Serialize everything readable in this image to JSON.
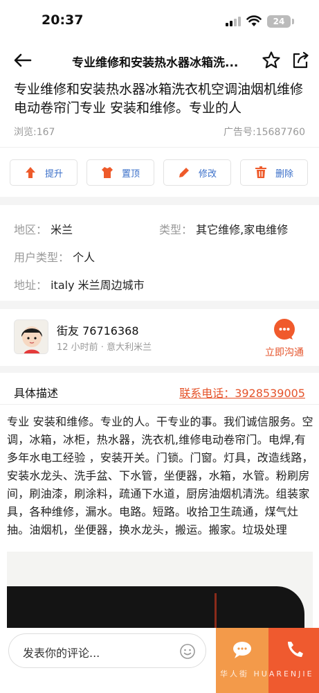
{
  "status_bar": {
    "time": "20:37",
    "battery": "24"
  },
  "nav": {
    "title": "专业维修和安装热水器冰箱洗..."
  },
  "post": {
    "headline": "专业维修和安装热水器冰箱洗衣机空调油烟机维修电动卷帘门专业 安装和维修。专业的人",
    "views": "浏览:167",
    "ad_number": "广告号:15687760"
  },
  "actions": [
    {
      "label": "提升",
      "icon": "arrow-up-icon"
    },
    {
      "label": "置顶",
      "icon": "shirt-icon"
    },
    {
      "label": "修改",
      "icon": "pencil-icon"
    },
    {
      "label": "删除",
      "icon": "trash-icon"
    }
  ],
  "info": {
    "region_label": "地区：",
    "region_value": "米兰",
    "type_label": "类型：",
    "type_value": "其它维修,家电维修",
    "user_type_label": "用户类型：",
    "user_type_value": "个人",
    "address_label": "地址：",
    "address_value": "italy 米兰周边城市"
  },
  "user": {
    "name": "街友 76716368",
    "subtitle": "12 小时前 · 意大利米兰",
    "chat_label": "立即沟通"
  },
  "description": {
    "title": "具体描述",
    "phone": "联系电话：3928539005",
    "body": "专业 安装和维修。专业的人。干专业的事。我们诚信服务。空调，冰箱，冰柜，热水器，洗衣机,维修电动卷帘门。电焊,有多年水电工经验 ，安装开关。门锁。门窗。灯具，改造线路，安装水龙头、洗手盆、下水管，坐便器，水箱，水管。粉刷房间，刷油漆，刷涂料，疏通下水道，厨房油烟机清洗。组装家具，各种维修，漏水。电路。短路。收拾卫生疏通，煤气灶抽。油烟机，坐便器，换水龙头，搬运。搬家。垃圾处理"
  },
  "bottom": {
    "comment_placeholder": "发表你的评论...",
    "watermark": "华人街 HUARENJIE"
  },
  "colors": {
    "accent_orange": "#e5532a",
    "link_blue": "#3a6fc9",
    "message_button": "#f39a4a",
    "call_button": "#ef5a2f"
  }
}
